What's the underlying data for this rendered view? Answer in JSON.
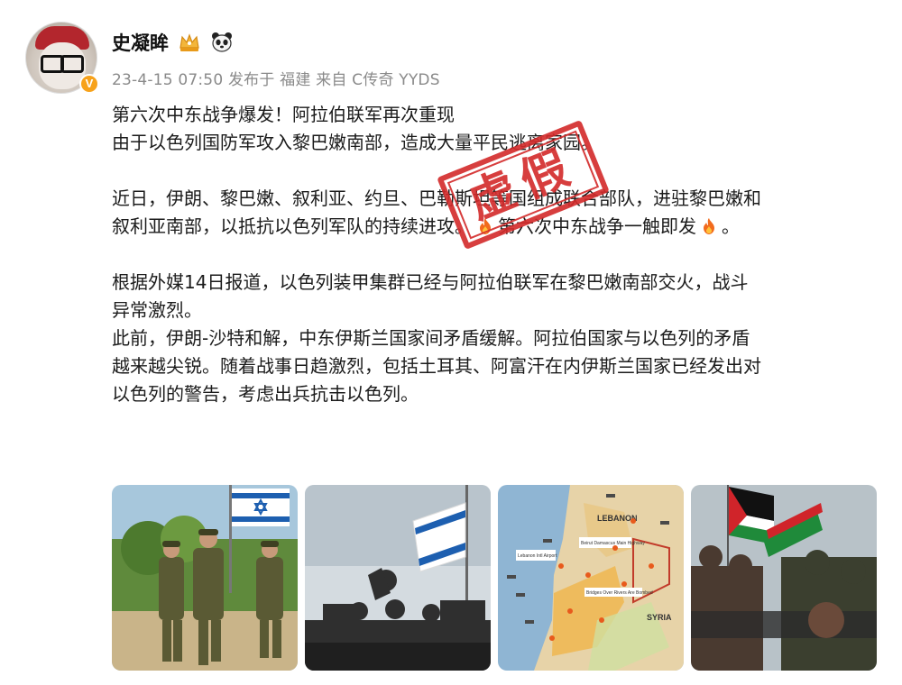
{
  "user": {
    "name": "史凝眸",
    "verified_badge": "V",
    "avatar_icon": "avatar-glasses-red-hat",
    "badges": [
      "crown-badge-icon",
      "panda-icon"
    ]
  },
  "meta": {
    "time": "23-4-15 07:50",
    "published_at": "发布于 福建",
    "source": "来自 C传奇 YYDS"
  },
  "post": {
    "lines": {
      "l1": "第六次中东战争爆发！阿拉伯联军再次重现",
      "l2": "由于以色列国防军攻入黎巴嫩南部，造成大量平民逃离家园。",
      "l3": "近日，伊朗、黎巴嫩、叙利亚、约旦、巴勒斯坦等国组成联合部队，进驻黎巴嫩和",
      "l4a": "叙利亚南部，以抵抗以色列军队的持续进攻。",
      "l4b": "第六次中东战争一触即发",
      "l4c": "。",
      "l5": "根据外媒14日报道，以色列装甲集群已经与阿拉伯联军在黎巴嫩南部交火，战斗",
      "l6": "异常激烈。",
      "l7": "此前，伊朗-沙特和解，中东伊斯兰国家间矛盾缓解。阿拉伯国家与以色列的矛盾",
      "l8": "越来越尖锐。随着战事日趋激烈，包括土耳其、阿富汗在内伊斯兰国家已经发出对",
      "l9": "以色列的警告，考虑出兵抗击以色列。"
    },
    "stamp_text": "虚假"
  },
  "images": {
    "map": {
      "lebanon": "LEBANON",
      "syria": "SYRIA",
      "beirut": "Beirut Damascus Main Highway",
      "airport": "Lebanon Intl Airport",
      "bridges": "Bridges Over Rivers Are Bombed"
    }
  },
  "colors": {
    "stamp": "#d32a2a",
    "meta_text": "#8a8a8a",
    "verified": "#f7a21b"
  }
}
